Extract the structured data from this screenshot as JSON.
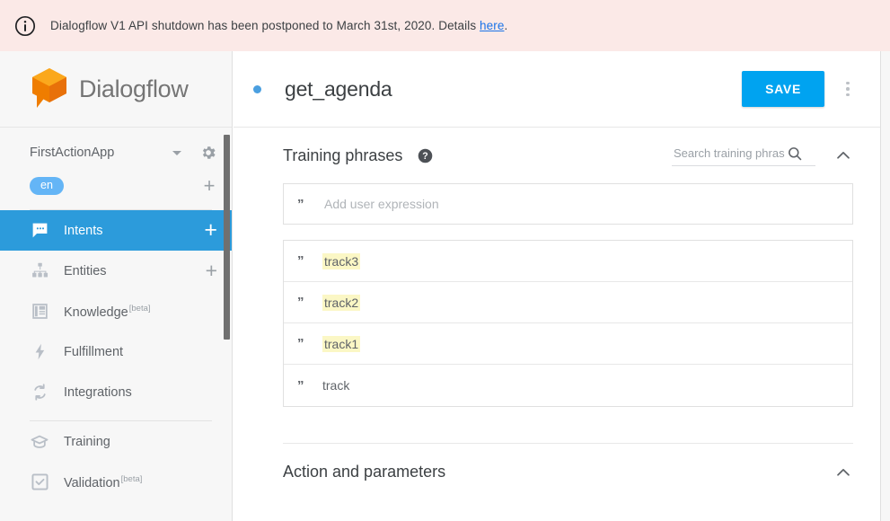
{
  "banner": {
    "icon": "info-icon",
    "text_before": "Dialogflow V1 API shutdown has been postponed to March 31st, 2020. Details ",
    "link_text": "here",
    "text_after": ".",
    "background": "#fbe9e7",
    "link_color": "#1a73e8"
  },
  "sidebar": {
    "logo_text": "Dialogflow",
    "logo_color": "#f79b1d",
    "project": {
      "name": "FirstActionApp",
      "dropdown_icon": "chevron-down-icon",
      "settings_icon": "gear-icon"
    },
    "language": {
      "code": "en",
      "chip_color": "#64b5f6",
      "add_icon": "plus-icon"
    },
    "items": [
      {
        "label": "Intents",
        "icon": "chat-bubble-icon",
        "active": true,
        "action_icon": "plus-icon",
        "beta": ""
      },
      {
        "label": "Entities",
        "icon": "hierarchy-icon",
        "active": false,
        "action_icon": "plus-icon",
        "beta": ""
      },
      {
        "label": "Knowledge",
        "icon": "book-icon",
        "active": false,
        "action_icon": "",
        "beta": "[beta]"
      },
      {
        "label": "Fulfillment",
        "icon": "lightning-bolt-icon",
        "active": false,
        "action_icon": "",
        "beta": ""
      },
      {
        "label": "Integrations",
        "icon": "sync-icon",
        "active": false,
        "action_icon": "",
        "beta": ""
      },
      {
        "label": "Training",
        "icon": "graduation-cap-icon",
        "active": false,
        "action_icon": "",
        "beta": ""
      },
      {
        "label": "Validation",
        "icon": "checkbox-icon",
        "active": false,
        "action_icon": "",
        "beta": "[beta]"
      }
    ],
    "active_color": "#2c9bdb"
  },
  "intent": {
    "status_dot_color": "#4a9fe0",
    "title": "get_agenda",
    "save_label": "SAVE",
    "save_color": "#00a3f0",
    "menu_icon": "kebab-menu-icon"
  },
  "training_phrases": {
    "title": "Training phrases",
    "help_icon": "help-circle-icon",
    "search_placeholder": "Search training phrases",
    "search_value": "",
    "search_icon": "search-icon",
    "collapse_icon": "chevron-up-icon",
    "add_placeholder": "Add user expression",
    "add_value": "",
    "quote_icon": "quote-icon",
    "highlight_color": "#fbf7c5",
    "rows": [
      {
        "text": "track3",
        "highlighted": true
      },
      {
        "text": "track2",
        "highlighted": true
      },
      {
        "text": "track1",
        "highlighted": true
      },
      {
        "text": "track",
        "highlighted": false
      }
    ]
  },
  "action_parameters": {
    "title": "Action and parameters",
    "collapse_icon": "chevron-up-icon"
  }
}
